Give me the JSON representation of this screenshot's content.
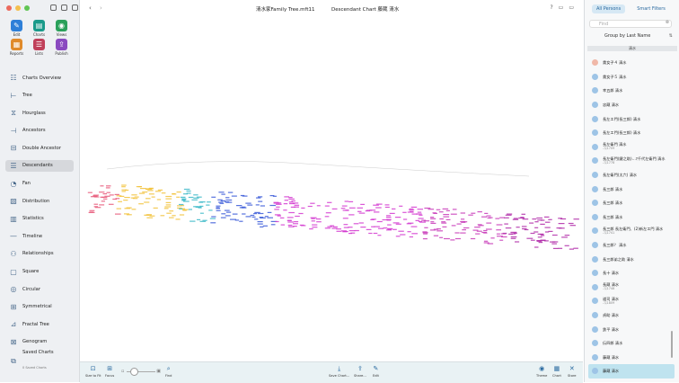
{
  "window": {
    "document_title": "清水家Family Tree.mft11",
    "chart_title": "Descendant Chart 藤蔵 清水",
    "colors": {
      "accent": "#2a6aa0",
      "selected_row": "#bfe3ef"
    }
  },
  "toolbar_quick": [
    {
      "label": "Edit",
      "icon": "pencil-icon",
      "color": "#2e7fd8"
    },
    {
      "label": "Charts",
      "icon": "chart-icon",
      "color": "#1a9a8a"
    },
    {
      "label": "Views",
      "icon": "eye-icon",
      "color": "#2aa05a"
    },
    {
      "label": "Reports",
      "icon": "report-icon",
      "color": "#e08a2a"
    },
    {
      "label": "Lists",
      "icon": "list-icon",
      "color": "#c0405a"
    },
    {
      "label": "Publish",
      "icon": "publish-icon",
      "color": "#8a4ac0"
    }
  ],
  "nav": [
    {
      "label": "Charts Overview",
      "icon": "overview-icon"
    },
    {
      "label": "Tree",
      "icon": "tree-icon"
    },
    {
      "label": "Hourglass",
      "icon": "hourglass-icon"
    },
    {
      "label": "Ancestors",
      "icon": "ancestors-icon"
    },
    {
      "label": "Double Ancestor",
      "icon": "double-ancestor-icon"
    },
    {
      "label": "Descendants",
      "icon": "descendants-icon",
      "selected": true
    },
    {
      "label": "Fan",
      "icon": "fan-icon"
    },
    {
      "label": "Distribution",
      "icon": "distribution-icon"
    },
    {
      "label": "Statistics",
      "icon": "statistics-icon"
    },
    {
      "label": "Timeline",
      "icon": "timeline-icon"
    },
    {
      "label": "Relationships",
      "icon": "relationships-icon"
    },
    {
      "label": "Square",
      "icon": "square-icon"
    },
    {
      "label": "Circular",
      "icon": "circular-icon"
    },
    {
      "label": "Symmetrical",
      "icon": "symmetrical-icon"
    },
    {
      "label": "Fractal Tree",
      "icon": "fractal-tree-icon"
    },
    {
      "label": "Genogram",
      "icon": "genogram-icon"
    }
  ],
  "saved_charts": {
    "label": "Saved Charts",
    "sub": "0 Saved Charts"
  },
  "bottom_left": [
    {
      "label": "Size to Fit",
      "icon": "size-to-fit-icon"
    },
    {
      "label": "Focus",
      "icon": "focus-icon"
    },
    {
      "label": "Find",
      "icon": "find-icon"
    }
  ],
  "bottom_center": [
    {
      "label": "Save Chart...",
      "icon": "save-chart-icon"
    },
    {
      "label": "Share...",
      "icon": "share-icon"
    },
    {
      "label": "Edit",
      "icon": "edit-icon"
    }
  ],
  "bottom_right": [
    {
      "label": "Theme",
      "icon": "theme-icon"
    },
    {
      "label": "Chart",
      "icon": "chart-icon"
    },
    {
      "label": "Store",
      "icon": "store-icon"
    }
  ],
  "right_panel": {
    "tabs": [
      "All Persons",
      "Smart Filters"
    ],
    "find_placeholder": "Find",
    "group_by": "Group by Last Name",
    "section": "清水",
    "persons": [
      {
        "name": "貴女子４ 清水",
        "dates": "",
        "female": true
      },
      {
        "name": "貴女子５ 清水",
        "dates": ""
      },
      {
        "name": "幸五郎 清水",
        "dates": ""
      },
      {
        "name": "忠蔵 清水",
        "dates": ""
      },
      {
        "name": "長左エ門(長三郎) 清水",
        "dates": ""
      },
      {
        "name": "長左エ門(長三郎) 清水",
        "dates": ""
      },
      {
        "name": "長左衛門 清水",
        "dates": "-ﾏｽ1709"
      },
      {
        "name": "長左衛門(鍵之助)…ﾏ千代左衛門 清水",
        "dates": "-ﾏｽ1778"
      },
      {
        "name": "長左衛門(太六) 清水",
        "dates": ""
      },
      {
        "name": "長三郎 清水",
        "dates": ""
      },
      {
        "name": "長三郎 清水",
        "dates": ""
      },
      {
        "name": "長三郎 清水",
        "dates": ""
      },
      {
        "name": "長三郎 長左衛門、(2)新左エ門 清水",
        "dates": "-ﾏｽ1741"
      },
      {
        "name": "長三郎？ 清水",
        "dates": ""
      },
      {
        "name": "長三郎弟之助 清水",
        "dates": ""
      },
      {
        "name": "長十 清水",
        "dates": ""
      },
      {
        "name": "長蔵 清水",
        "dates": "-ﾏｽ1748"
      },
      {
        "name": "道司 清水",
        "dates": "-ﾏｽ1809"
      },
      {
        "name": "貞助 清水",
        "dates": ""
      },
      {
        "name": "鉄平 清水",
        "dates": ""
      },
      {
        "name": "伝四郎 清水",
        "dates": ""
      },
      {
        "name": "藤蔵 清水",
        "dates": ""
      },
      {
        "name": "藤蔵 清水",
        "dates": "",
        "selected": true
      }
    ]
  }
}
